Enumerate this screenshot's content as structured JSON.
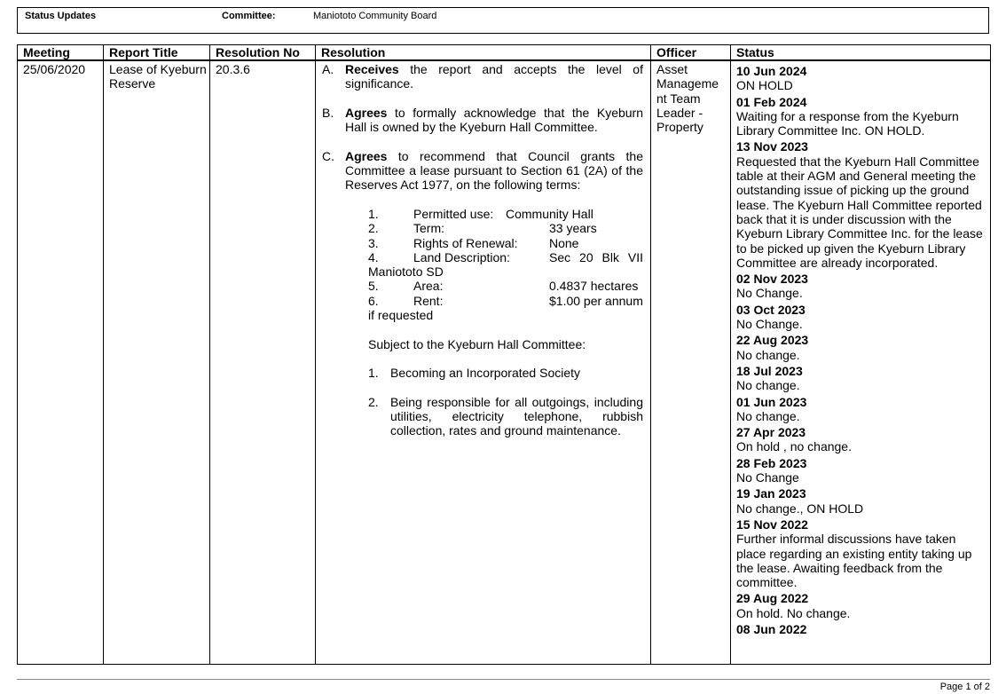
{
  "header": {
    "status_label": "Status Updates",
    "committee_label": "Committee:",
    "committee_name": "Maniototo Community Board"
  },
  "table": {
    "columns": [
      "Meeting",
      "Report Title",
      "Resolution No",
      "Resolution",
      "Officer",
      "Status"
    ],
    "row": {
      "meeting": "25/06/2020",
      "report_title": "Lease of Kyeburn Reserve",
      "resolution_no": "20.3.6",
      "officer": "Asset Manageme nt Team Leader - Property"
    }
  },
  "resolution": {
    "a_letter": "A.",
    "a_bold": "Receives",
    "a_text": " the report and accepts the level of significance.",
    "b_letter": "B.",
    "b_bold": "Agrees",
    "b_text": " to formally acknowledge that the Kyeburn Hall is owned by the Kyeburn Hall Committee.",
    "c_letter": "C.",
    "c_bold": "Agrees",
    "c_text": " to recommend that Council grants the Committee a lease pursuant to Section 61 (2A) of the Reserves Act 1977, on the following terms:",
    "terms": [
      {
        "n": "1.",
        "label": "Permitted use:",
        "value": "Community Hall"
      },
      {
        "n": "2.",
        "label": "Term:",
        "value": "33 years"
      },
      {
        "n": "3.",
        "label": "Rights of Renewal:",
        "value": "None"
      },
      {
        "n": "4.",
        "label": "Land Description:",
        "value": "Sec 20 Blk VII",
        "cont": "Maniototo SD"
      },
      {
        "n": "5.",
        "label": "Area:",
        "value": "0.4837 hectares"
      },
      {
        "n": "6.",
        "label": "Rent:",
        "value": "$1.00 per annum",
        "cont": "if requested"
      }
    ],
    "subject_intro": "Subject to the Kyeburn Hall Committee:",
    "subject_items": [
      {
        "n": "1.",
        "text": "Becoming an Incorporated Society"
      },
      {
        "n": "2.",
        "text": "Being responsible for all outgoings, including utilities, electricity telephone, rubbish collection, rates and ground maintenance."
      }
    ]
  },
  "status_updates": [
    {
      "date": "10 Jun 2024",
      "text": "ON HOLD"
    },
    {
      "date": "01 Feb 2024",
      "text": "Waiting for a response from the Kyeburn Library Committee Inc. ON HOLD."
    },
    {
      "date": "13 Nov 2023",
      "text": "Requested that the Kyeburn Hall Committee table at their AGM and General meeting the outstanding issue of picking up the ground lease.  The Kyeburn Hall Committee reported back that it is under discussion with the Kyeburn Library Committee Inc. for the lease to be picked up given the Kyeburn Library Committee are already incorporated."
    },
    {
      "date": "02 Nov 2023",
      "text": "No Change."
    },
    {
      "date": "03 Oct 2023",
      "text": "No Change."
    },
    {
      "date": "22 Aug 2023",
      "text": "No change."
    },
    {
      "date": "18 Jul 2023",
      "text": "No change."
    },
    {
      "date": "01 Jun 2023",
      "text": "No change."
    },
    {
      "date": "27 Apr 2023",
      "text": "On hold , no change."
    },
    {
      "date": "28 Feb 2023",
      "text": "No Change"
    },
    {
      "date": "19 Jan 2023",
      "text": "No change., ON HOLD"
    },
    {
      "date": "15 Nov 2022",
      "text": "Further informal discussions have taken place regarding an existing entity taking up the lease. Awaiting feedback from the committee."
    },
    {
      "date": "29 Aug 2022",
      "text": "On hold. No change."
    },
    {
      "date": "08 Jun 2022",
      "text": ""
    }
  ],
  "footer": {
    "page": "Page 1 of 2"
  }
}
